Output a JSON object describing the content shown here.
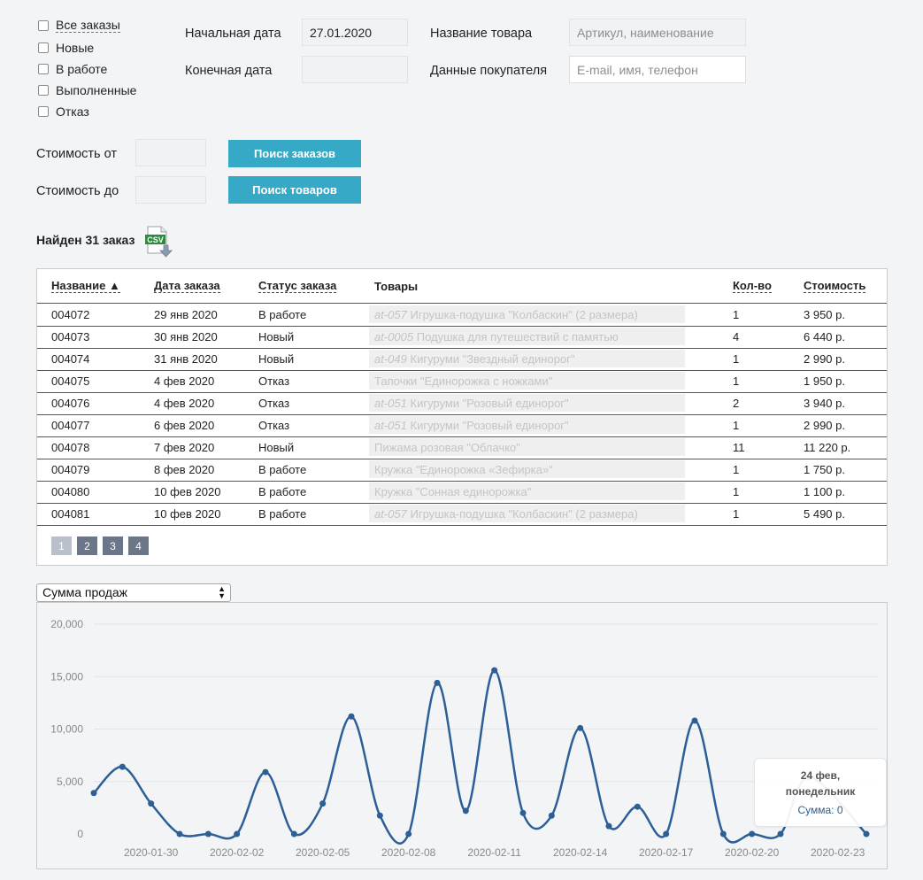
{
  "filters": {
    "status": {
      "all": "Все заказы",
      "items": [
        "Новые",
        "В работе",
        "Выполненные",
        "Отказ"
      ]
    },
    "start_date": {
      "label": "Начальная дата",
      "value": "27.01.2020"
    },
    "end_date": {
      "label": "Конечная дата",
      "value": ""
    },
    "product_name": {
      "label": "Название товара",
      "placeholder": "Артикул, наименование"
    },
    "buyer": {
      "label": "Данные покупателя",
      "placeholder": "E-mail, имя, телефон"
    },
    "price_from": {
      "label": "Стоимость от",
      "value": ""
    },
    "price_to": {
      "label": "Стоимость до",
      "value": ""
    },
    "search_orders_label": "Поиск заказов",
    "search_products_label": "Поиск товаров"
  },
  "results": {
    "found_text": "Найден 31 заказ",
    "csv_icon_text": "CSV"
  },
  "table": {
    "headers": {
      "name": "Название ▲",
      "date": "Дата заказа",
      "status": "Статус заказа",
      "goods": "Товары",
      "qty": "Кол-во",
      "cost": "Стоимость"
    },
    "rows": [
      {
        "name": "004072",
        "date": "29 янв 2020",
        "status": "В работе",
        "sku": "at-057",
        "goods": "Игрушка-подушка \"Колбаскин\" (2 размера)",
        "qty": "1",
        "cost": "3 950 р."
      },
      {
        "name": "004073",
        "date": "30 янв 2020",
        "status": "Новый",
        "sku": "at-0005",
        "goods": "Подушка для путешествий с памятью",
        "qty": "4",
        "cost": "6 440 р."
      },
      {
        "name": "004074",
        "date": "31 янв 2020",
        "status": "Новый",
        "sku": "at-049",
        "goods": "Кигуруми \"Звездный единорог\"",
        "qty": "1",
        "cost": "2 990 р."
      },
      {
        "name": "004075",
        "date": "4 фев 2020",
        "status": "Отказ",
        "sku": "",
        "goods": "Тапочки \"Единорожка с ножками\"",
        "qty": "1",
        "cost": "1 950 р."
      },
      {
        "name": "004076",
        "date": "4 фев 2020",
        "status": "Отказ",
        "sku": "at-051",
        "goods": "Кигуруми \"Розовый единорог\"",
        "qty": "2",
        "cost": "3 940 р."
      },
      {
        "name": "004077",
        "date": "6 фев 2020",
        "status": "Отказ",
        "sku": "at-051",
        "goods": "Кигуруми \"Розовый единорог\"",
        "qty": "1",
        "cost": "2 990 р."
      },
      {
        "name": "004078",
        "date": "7 фев 2020",
        "status": "Новый",
        "sku": "",
        "goods": "Пижама розовая \"Облачко\"",
        "qty": "11",
        "cost": "11 220 р."
      },
      {
        "name": "004079",
        "date": "8 фев 2020",
        "status": "В работе",
        "sku": "",
        "goods": "Кружка \"Единорожка «Зефирка»\"",
        "qty": "1",
        "cost": "1 750 р."
      },
      {
        "name": "004080",
        "date": "10 фев 2020",
        "status": "В работе",
        "sku": "",
        "goods": "Кружка \"Сонная единорожка\"",
        "qty": "1",
        "cost": "1 100 р."
      },
      {
        "name": "004081",
        "date": "10 фев 2020",
        "status": "В работе",
        "sku": "at-057",
        "goods": "Игрушка-подушка \"Колбаскин\" (2 размера)",
        "qty": "1",
        "cost": "5 490 р."
      }
    ],
    "pages": [
      "1",
      "2",
      "3",
      "4"
    ],
    "active_page": "1"
  },
  "chart_select": {
    "value": "Сумма продаж"
  },
  "colors": {
    "accent": "#36a9c6",
    "line": "#2c5f96",
    "pager": "#6b7789"
  },
  "chart_data": {
    "type": "line",
    "series": [
      {
        "values": [
          3900,
          6400,
          2900,
          0,
          0,
          0,
          5900,
          0,
          2900,
          11200,
          1750,
          0,
          14400,
          2200,
          15600,
          2000,
          1750,
          10100,
          750,
          2600,
          0,
          10800,
          0,
          0,
          0,
          5400,
          0
        ]
      }
    ],
    "x": [
      "2020-01-28",
      "2020-01-29",
      "2020-01-30",
      "2020-01-31",
      "2020-02-01",
      "2020-02-02",
      "2020-02-03",
      "2020-02-04",
      "2020-02-05",
      "2020-02-06",
      "2020-02-07",
      "2020-02-08",
      "2020-02-09",
      "2020-02-10",
      "2020-02-11",
      "2020-02-12",
      "2020-02-13",
      "2020-02-14",
      "2020-02-15",
      "2020-02-16",
      "2020-02-17",
      "2020-02-18",
      "2020-02-19",
      "2020-02-20",
      "2020-02-21",
      "2020-02-22",
      "2020-02-24"
    ],
    "x_ticks": [
      "2020-01-30",
      "2020-02-02",
      "2020-02-05",
      "2020-02-08",
      "2020-02-11",
      "2020-02-14",
      "2020-02-17",
      "2020-02-20",
      "2020-02-23"
    ],
    "y_ticks": [
      "0",
      "5,000",
      "10,000",
      "15,000",
      "20,000"
    ],
    "ylim": [
      0,
      20000
    ],
    "grid": true,
    "tooltip": {
      "date": "24 фев,",
      "weekday": "понедельник",
      "label": "Сумма: 0"
    }
  }
}
